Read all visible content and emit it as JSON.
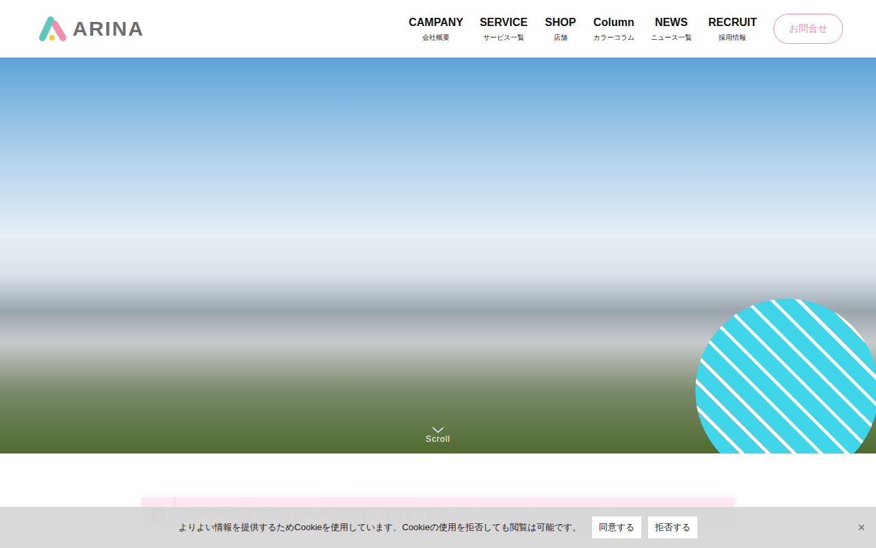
{
  "logo": {
    "text": "ARINA"
  },
  "nav": [
    {
      "label": "CAMPANY",
      "sub": "会社概要"
    },
    {
      "label": "SERVICE",
      "sub": "サービス一覧"
    },
    {
      "label": "SHOP",
      "sub": "店舗"
    },
    {
      "label": "Column",
      "sub": "カラーコラム"
    },
    {
      "label": "NEWS",
      "sub": "ニュース一覧"
    },
    {
      "label": "RECRUIT",
      "sub": "採用情報"
    }
  ],
  "contact_button": "お問合せ",
  "hero": {
    "scroll": "Scroll"
  },
  "notice": {
    "icon": "i",
    "text": "ARINA株式会社はARINA partners株式会社に名称変更しました。"
  },
  "cookie": {
    "text": "よりよい情報を提供するためCookieを使用しています。Cookieの使用を拒否しても閲覧は可能です。",
    "buttons": [
      "同意する",
      "拒否する"
    ],
    "close": "×"
  }
}
